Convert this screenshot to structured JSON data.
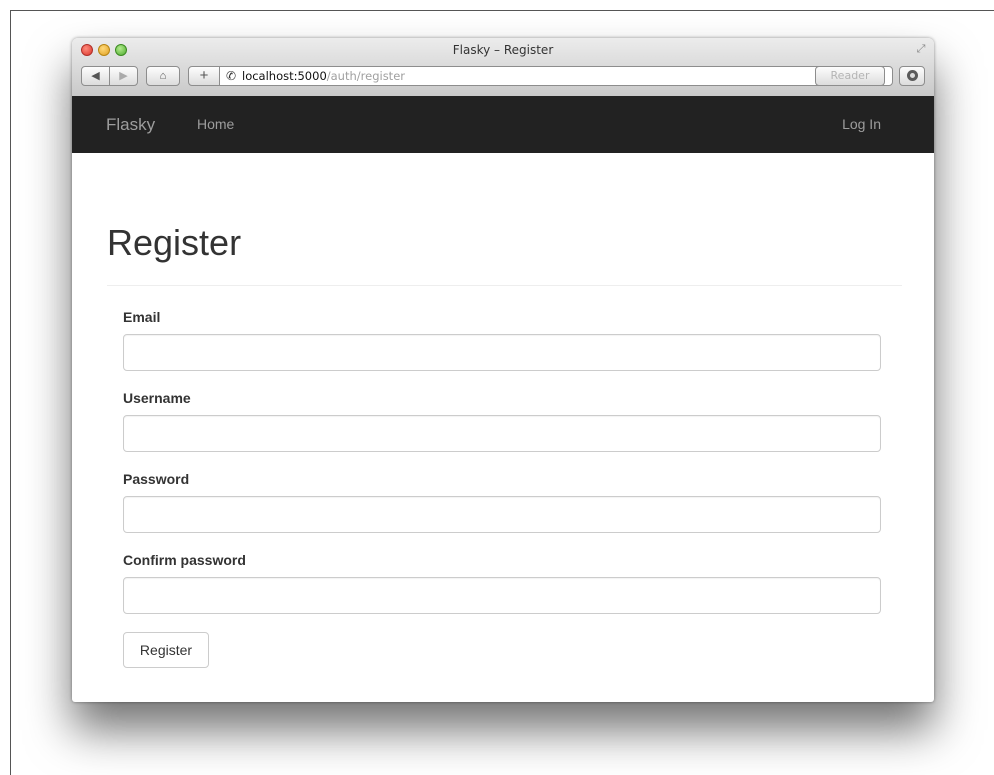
{
  "window": {
    "title": "Flasky – Register"
  },
  "toolbar": {
    "back_icon": "◀",
    "forward_icon": "▶",
    "home_icon": "⌂",
    "add_icon": "+",
    "phone_icon": "✆",
    "reload_icon": "↻",
    "fullscreen_icon": "⤢",
    "reader_label": "Reader"
  },
  "url": {
    "host": "localhost:5000",
    "path": "/auth/register"
  },
  "navbar": {
    "brand": "Flasky",
    "links": [
      {
        "label": "Home"
      }
    ],
    "right_links": [
      {
        "label": "Log In"
      }
    ],
    "background": "#222222",
    "text_color": "#9d9d9d"
  },
  "page": {
    "title": "Register"
  },
  "form": {
    "fields": [
      {
        "label": "Email",
        "value": ""
      },
      {
        "label": "Username",
        "value": ""
      },
      {
        "label": "Password",
        "value": ""
      },
      {
        "label": "Confirm password",
        "value": ""
      }
    ],
    "submit_label": "Register"
  }
}
